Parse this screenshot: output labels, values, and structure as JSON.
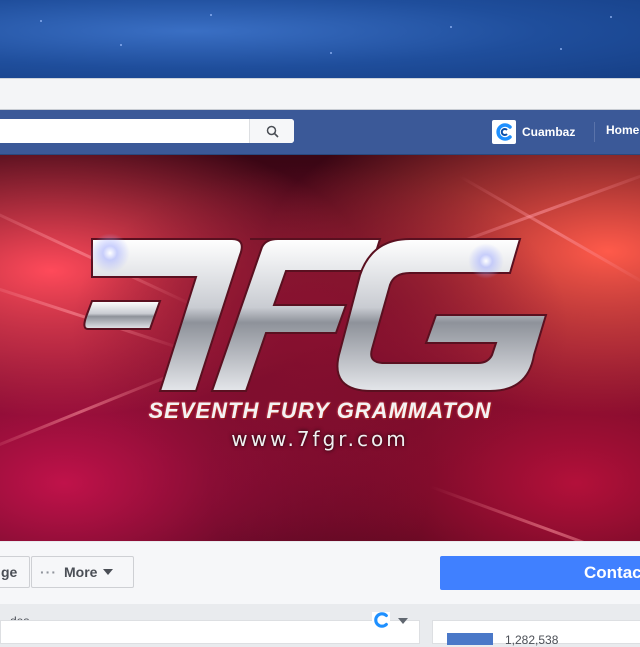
{
  "search": {
    "placeholder": ""
  },
  "topbar": {
    "profile_name": "Cuambaz",
    "home_label": "Home"
  },
  "cover": {
    "logo_text": "7FG",
    "tagline": "SEVENTH FURY GRAMMATON",
    "url": "www.7fgr.com"
  },
  "actions": {
    "like_label": "ge",
    "more_dots": "···",
    "more_label": "More",
    "contact_label": "Contac"
  },
  "bottom": {
    "left_text": "...des",
    "right_text": "1,282,538"
  },
  "colors": {
    "fb_blue": "#3b5998",
    "contact_blue": "#4080ff",
    "cover_red": "#8a1030"
  },
  "icons": [
    "search-icon",
    "profile-logo-icon",
    "caret-down-icon",
    "page-logo-icon"
  ]
}
